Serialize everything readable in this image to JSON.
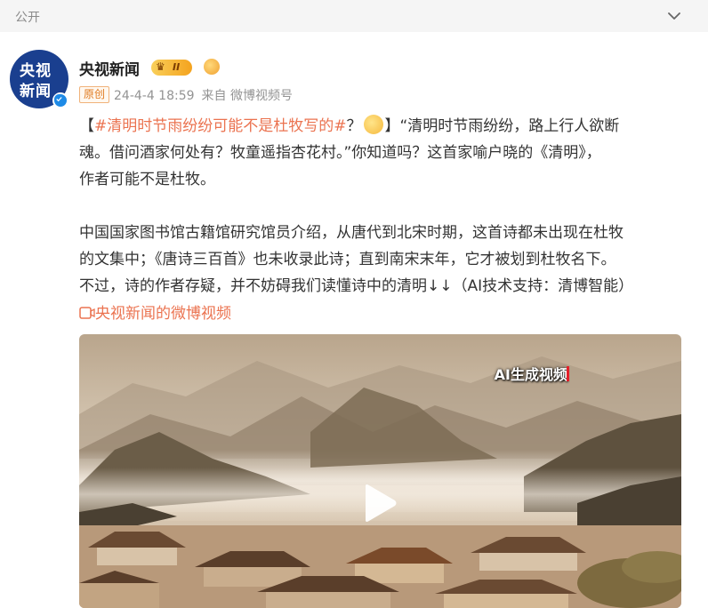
{
  "visibility": "公开",
  "post": {
    "author": "央视新闻",
    "avatar_text_top": "央视",
    "avatar_text_bottom": "新闻",
    "vip_level": "II",
    "original_tag": "原创",
    "timestamp": "24-4-4 18:59",
    "source": "来自 微博视频号",
    "body": {
      "line1_open": "【",
      "topic": "#清明时节雨纷纷可能不是杜牧写的#",
      "line1_rest": "？",
      "line1_after": "】“清明时节雨纷纷，路上行人欲断",
      "line2": "魂。借问酒家何处有？牧童遥指杏花村。”你知道吗？这首家喻户晓的《清明》，",
      "line3": "作者可能不是杜牧。",
      "line4": "中国国家图书馆古籍馆研究馆员介绍，从唐代到北宋时期，这首诗都未出现在杜牧",
      "line5": "的文集中；《唐诗三百首》也未收录此诗；直到南宋末年，它才被划到杜牧名下。",
      "line6": "不过，诗的作者存疑，并不妨碍我们读懂诗中的清明↓↓（AI技术支持：清博智能）"
    },
    "video_link": "央视新闻的微博视频",
    "video_caption": "AI生成视频"
  },
  "colors": {
    "topic": "#eb7350",
    "meta": "#939393",
    "verified": "#1e8ae6"
  },
  "icons": [
    "chevron-down-icon",
    "crown-icon",
    "emoji-icon",
    "verified-icon",
    "video-icon",
    "play-icon"
  ]
}
